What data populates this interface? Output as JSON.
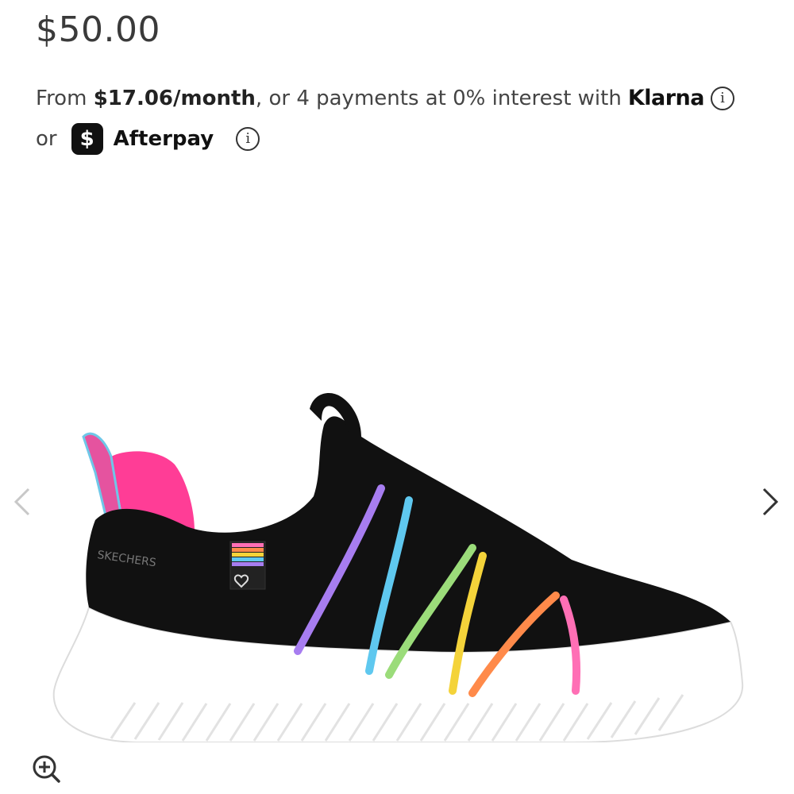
{
  "product": {
    "price": "$50.00"
  },
  "financing": {
    "prefix": "From",
    "monthly": "$17.06/month",
    "middle": ", or 4 payments at 0% interest with",
    "klarna": "Klarna",
    "or_text": "or",
    "cashapp_symbol": "$",
    "afterpay": "Afterpay"
  },
  "gallery": {
    "prev_icon": "chevron-left-icon",
    "next_icon": "chevron-right-icon",
    "zoom_icon": "zoom-in-icon",
    "brand_text": "SKECHERS"
  },
  "colors": {
    "upper": "#111111",
    "sole": "#ffffff",
    "heel_pink": "#ff3d96",
    "band_purple": "#a77df0",
    "band_blue": "#5fc8ef",
    "band_green": "#9bdc7a",
    "band_yellow": "#f4d33a",
    "band_orange": "#ff8a4a",
    "band_pink": "#ff6fb5"
  }
}
